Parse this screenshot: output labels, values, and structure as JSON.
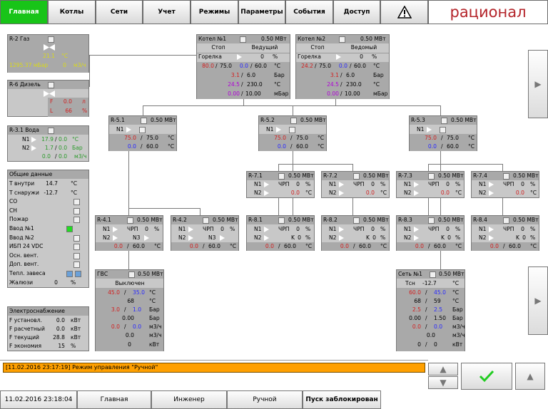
{
  "nav": {
    "tabs": [
      "Главная",
      "Котлы",
      "Сети",
      "Учет",
      "Режимы",
      "Параметры",
      "События",
      "Доступ"
    ],
    "active_tab": "Главная",
    "alarm_icon": "warning-icon",
    "logo": "рационал"
  },
  "gas": {
    "title": "R-2 Газ",
    "temp": "21.1",
    "temp_unit": "°C",
    "pressure": "1295.37 мБар",
    "flow": "0",
    "flow_unit": "м3/ч"
  },
  "diesel": {
    "title": "R-6 Дизель",
    "f_label": "F",
    "f_val": "0.0",
    "f_unit": "л",
    "l_label": "L",
    "l_val": "66",
    "l_unit": "%"
  },
  "water": {
    "title": "R-3.1 Вода",
    "n1": "N1",
    "n1_t1": "17.9",
    "n1_t2": "0.0",
    "n1_unit": "°C",
    "n2": "N2",
    "n2_p1": "1.7",
    "n2_p2": "0.0",
    "n2_unit": "Бар",
    "f1": "0.0",
    "f2": "0.0",
    "f_unit": "м3/ч"
  },
  "general": {
    "title": "Общие данные",
    "rows": [
      {
        "label": "T внутри",
        "value": "14.7",
        "unit": "°C"
      },
      {
        "label": "T снаружи",
        "value": "-12.7",
        "unit": "°C"
      },
      {
        "label": "CO"
      },
      {
        "label": "CH"
      },
      {
        "label": "Пожар"
      },
      {
        "label": "Ввод №1",
        "status": "green"
      },
      {
        "label": "Ввод №2"
      },
      {
        "label": "ИБП 24 VDC"
      },
      {
        "label": "Осн. вент."
      },
      {
        "label": "Доп. вент."
      },
      {
        "label": "Тепл. завеса",
        "status": "blue2"
      },
      {
        "label": "Жалюзи",
        "value": "0",
        "unit": "%"
      }
    ]
  },
  "power": {
    "title": "Электроснабжение",
    "rows": [
      {
        "label": "F установл.",
        "value": "0.0",
        "unit": "кВт"
      },
      {
        "label": "F расчетный",
        "value": "0.0",
        "unit": "кВт"
      },
      {
        "label": "F текущий",
        "value": "28.8",
        "unit": "кВт"
      },
      {
        "label": "F экономия",
        "value": "15",
        "unit": "%"
      }
    ]
  },
  "boilers": [
    {
      "title": "Котел №1",
      "power": "0.50 МВт",
      "state": "Стоп",
      "role": "Ведущий",
      "burner": "Горелка",
      "burner_val": "0",
      "burner_unit": "%",
      "t1": "80.0",
      "t1b": "75.0",
      "t1c": "0.0",
      "t1d": "60.0",
      "t_unit": "°C",
      "p1": "3.1",
      "p2": "6.0",
      "p_unit": "Бар",
      "q1": "24.5",
      "q2": "230.0",
      "q_unit": "°C",
      "r1": "0.00",
      "r2": "10.00",
      "r_unit": "мБар"
    },
    {
      "title": "Котел №2",
      "power": "0.50 МВт",
      "state": "Стоп",
      "role": "Ведомый",
      "burner": "Горелка",
      "burner_val": "0",
      "burner_unit": "%",
      "t1": "24.2",
      "t1b": "75.0",
      "t1c": "0.0",
      "t1d": "60.0",
      "t_unit": "°C",
      "p1": "3.1",
      "p2": "6.0",
      "p_unit": "Бар",
      "q1": "24.5",
      "q2": "230.0",
      "q_unit": "°C",
      "r1": "0.00",
      "r2": "10.00",
      "r_unit": "мБар"
    }
  ],
  "level2": [
    {
      "title": "R-5.1",
      "power": "0.50 МВт",
      "n1": "N1",
      "a": "75.0",
      "b": "75.0",
      "c": "0.0",
      "d": "60.0",
      "unit": "°C"
    },
    {
      "title": "R-5.2",
      "power": "0.50 МВт",
      "n1": "N1",
      "a": "75.0",
      "b": "75.0",
      "c": "0.0",
      "d": "60.0",
      "unit": "°C"
    },
    {
      "title": "R-5.3",
      "power": "0.50 МВт",
      "n1": "N1",
      "a": "75.0",
      "b": "75.0",
      "c": "0.0",
      "d": "60.0",
      "unit": "°C"
    }
  ],
  "level3a": [
    {
      "title": "R-7.1",
      "power": "0.50 МВт",
      "n1": "N1",
      "n2": "N2",
      "k": "ЧРП",
      "kv": "0",
      "ku": "%",
      "t": "0.0",
      "tu": "°C"
    },
    {
      "title": "R-7.2",
      "power": "0.50 МВт",
      "n1": "N1",
      "n2": "N2",
      "k": "ЧРП",
      "kv": "0",
      "ku": "%",
      "t": "0.0",
      "tu": "°C"
    },
    {
      "title": "R-7.3",
      "power": "0.50 МВт",
      "n1": "N1",
      "n2": "N2",
      "k": "ЧРП",
      "kv": "0",
      "ku": "%",
      "t": "0.0",
      "tu": "°C"
    },
    {
      "title": "R-7.4",
      "power": "0.50 МВт",
      "n1": "N1",
      "n2": "N2",
      "k": "ЧРП",
      "kv": "0",
      "ku": "%",
      "t": "0.0",
      "tu": "°C"
    }
  ],
  "level3b": [
    {
      "title": "R-4.1",
      "power": "0.50 МВт",
      "n1": "N1",
      "n2": "N2",
      "k1": "ЧРП",
      "k1v": "0",
      "k1u": "%",
      "k2": "N3",
      "c": "0.0",
      "d": "60.0",
      "unit": "°C"
    },
    {
      "title": "R-4.2",
      "power": "0.50 МВт",
      "n1": "N1",
      "n2": "N2",
      "k1": "ЧРП",
      "k1v": "0",
      "k1u": "%",
      "k2": "N3",
      "c": "0.0",
      "d": "60.0",
      "unit": "°C"
    },
    {
      "title": "R-8.1",
      "power": "0.50 МВт",
      "n1": "N1",
      "n2": "N2",
      "k1": "ЧРП",
      "k1v": "0",
      "k1u": "%",
      "k2": "K",
      "k2v": "0",
      "k2u": "%",
      "c": "0.0",
      "d": "60.0",
      "unit": "°C"
    },
    {
      "title": "R-8.2",
      "power": "0.50 МВт",
      "n1": "N1",
      "n2": "N2",
      "k1": "ЧРП",
      "k1v": "0",
      "k1u": "%",
      "k2": "K",
      "k2v": "0",
      "k2u": "%",
      "c": "0.0",
      "d": "60.0",
      "unit": "°C"
    },
    {
      "title": "R-8.3",
      "power": "0.50 МВт",
      "n1": "N1",
      "n2": "N2",
      "k1": "ЧРП",
      "k1v": "0",
      "k1u": "%",
      "k2": "K",
      "k2v": "0",
      "k2u": "%",
      "c": "0.0",
      "d": "60.0",
      "unit": "°C"
    },
    {
      "title": "R-8.4",
      "power": "0.50 МВт",
      "n1": "N1",
      "n2": "N2",
      "k1": "ЧРП",
      "k1v": "0",
      "k1u": "%",
      "k2": "K",
      "k2v": "0",
      "k2u": "%",
      "c": "0.0",
      "d": "60.0",
      "unit": "°C"
    }
  ],
  "gvs": {
    "title": "ГВС",
    "power": "0.50 МВт",
    "state": "Выключен",
    "t1": "45.0",
    "t2": "35.0",
    "t_unit": "°C",
    "t3": "68",
    "t3_unit": "°C",
    "p1": "3.0",
    "p2": "1.0",
    "p_unit": "Бар",
    "p3": "0.00",
    "p3_unit": "Бар",
    "f1": "0.0",
    "f2": "0.0",
    "f_unit": "м3/ч",
    "f3": "0.0",
    "f3_unit": "м3/ч",
    "e": "0",
    "e_unit": "кВт"
  },
  "net": {
    "title": "Сеть №1",
    "power": "0.50 МВт",
    "tsn_label": "Tсн",
    "tsn": "-12.7",
    "tsn_unit": "°C",
    "t1": "60.0",
    "t2": "45.0",
    "t_unit": "°C",
    "t3": "68",
    "t4": "59",
    "t34_unit": "°C",
    "p1": "2.5",
    "p2": "2.5",
    "p_unit": "Бар",
    "p3": "0.00",
    "p4": "1.50",
    "p34_unit": "Бар",
    "f1": "0.0",
    "f2": "0.0",
    "f_unit": "м3/ч",
    "f3": "0.0",
    "f3_unit": "м3/ч",
    "e1": "0",
    "e2": "0",
    "e_unit": "кВт"
  },
  "event": {
    "text": "[11.02.2016 23:17:19]  Режим управления \"Ручной\""
  },
  "bottom": {
    "datetime": "11.02.2016 23:18:04",
    "buttons": [
      "Главная",
      "Инженер",
      "Ручной",
      "Пуск заблокирован"
    ]
  },
  "colors": {
    "active_tab": "#18c418",
    "event_bar": "#ffa000",
    "check": "#22cc22",
    "logo": "#b4242a"
  }
}
